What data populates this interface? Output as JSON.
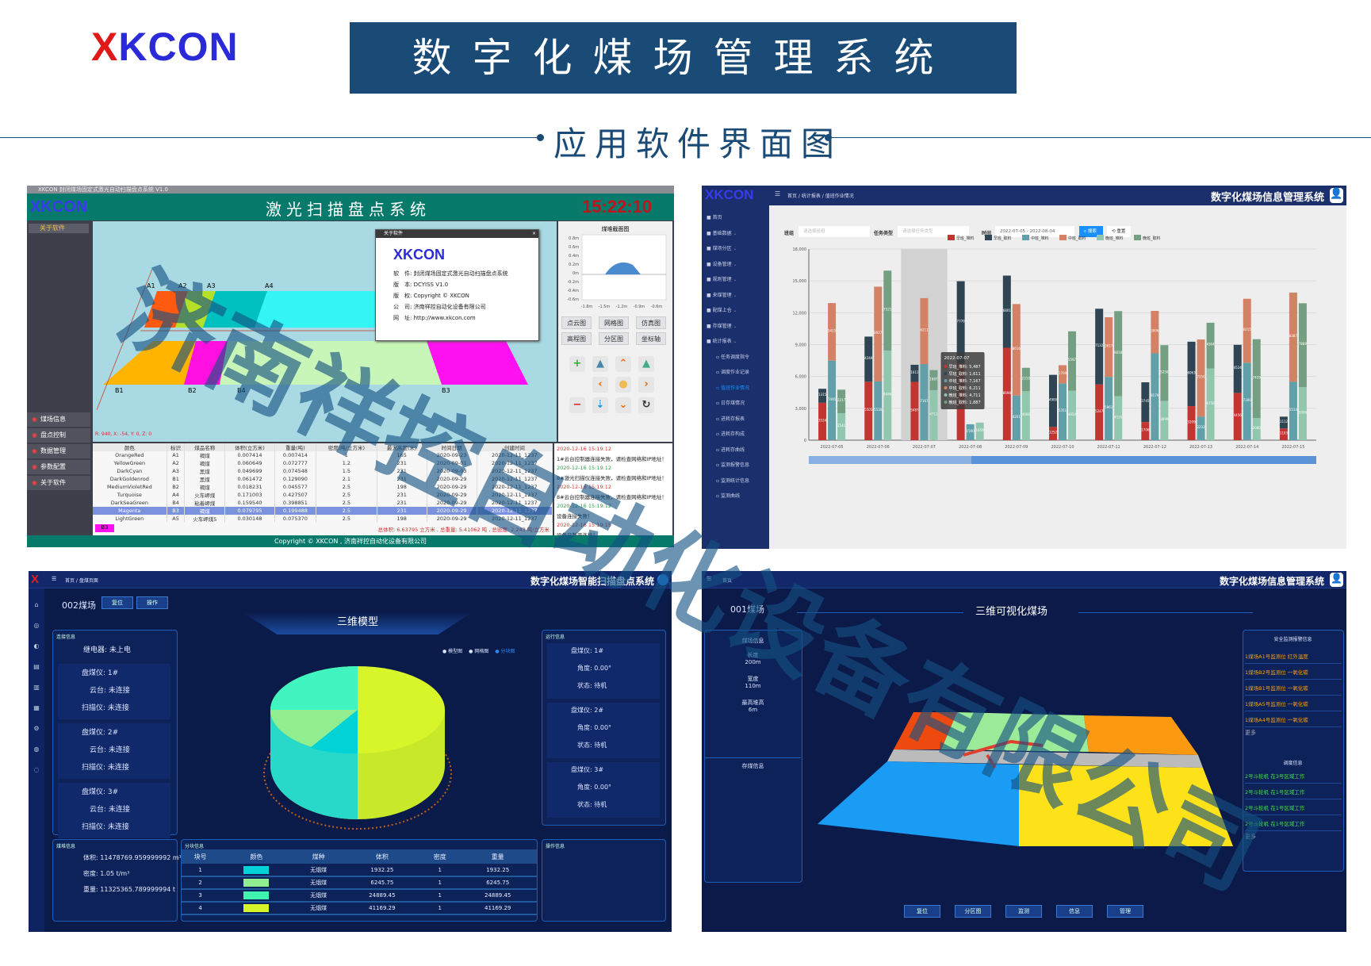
{
  "brand": {
    "logo_x": "X",
    "logo_rest": "KCON",
    "title": "数字化煤场管理系统",
    "subtitle": "应用软件界面图"
  },
  "watermark": "济南祥控自动化设备有限公司",
  "laser": {
    "window_title": "XKCON 封闭煤场固定式激光自动扫描盘点系统 V1.0",
    "logo": "XKCON",
    "title": "激光扫描盘点系统",
    "clock": "15:22:10",
    "clock_color": "#c0141c",
    "side_top": "关于软件",
    "nav": [
      "煤场信息",
      "盘点控制",
      "数据管理",
      "参数配置",
      "关于软件"
    ],
    "zones": {
      "A1": "A1",
      "A2": "A2",
      "A3": "A3",
      "A4": "A4",
      "B1": "B1",
      "B2": "B2",
      "B4": "B4",
      "B3": "B3"
    },
    "coord": "R: 940, X: -54, Y: 0, Z: 0",
    "about": {
      "title": "关于软件",
      "logo": "XKCON",
      "rows": [
        {
          "k": "软　件:",
          "v": "封闭煤场固定式激光自动扫描盘点系统"
        },
        {
          "k": "版　本:",
          "v": "DCYISS V1.0"
        },
        {
          "k": "版　权:",
          "v": "Copyright © XKCON"
        },
        {
          "k": "公　司:",
          "v": "济南祥控自动化设备有限公司"
        },
        {
          "k": "网　址:",
          "v": "http://www.xkcon.com"
        }
      ]
    },
    "section": {
      "title": "煤堆截面图",
      "y_ticks": [
        "0.8m",
        "0.6m",
        "0.4m",
        "0.2m",
        "0m",
        "-0.2m",
        "-0.4m",
        "-0.6m"
      ],
      "x_ticks": [
        "-1.8m",
        "-1.5m",
        "-1.2m",
        "-0.9m",
        "-0.6m"
      ]
    },
    "view_buttons": [
      "点云图",
      "网格图",
      "仿真图",
      "高程图",
      "分区图",
      "坐标轴"
    ],
    "table": {
      "headers": [
        "颜色",
        "标识",
        "煤品名称",
        "体积(立方米)",
        "重量(吨)",
        "密度(吨/立方米)",
        "最大高度(米)",
        "时间日期",
        "创建时间"
      ],
      "rows": [
        [
          "OrangeRed",
          "A1",
          "褐煤",
          "0.007414",
          "0.007414",
          "1",
          "165",
          "2020-09-23",
          "2020-12-11_1237"
        ],
        [
          "YellowGreen",
          "A2",
          "褐煤",
          "0.060649",
          "0.072777",
          "1.2",
          "231",
          "2020-09-01",
          "2020-12-11_1237"
        ],
        [
          "DarkCyan",
          "A3",
          "黑煤",
          "0.049699",
          "0.074548",
          "1.5",
          "231",
          "2020-09-03",
          "2020-12-11_1237"
        ],
        [
          "DarkGoldenrod",
          "B1",
          "黑煤",
          "0.061472",
          "0.129090",
          "2.1",
          "231",
          "2020-09-29",
          "2020-12-11_1237"
        ],
        [
          "MediumVioletRed",
          "B2",
          "褐煤",
          "0.018231",
          "0.045577",
          "2.5",
          "198",
          "2020-09-29",
          "2020-12-11_1237"
        ],
        [
          "Turquoise",
          "A4",
          "火车岬煤",
          "0.171003",
          "0.427507",
          "2.5",
          "231",
          "2020-09-29",
          "2020-12-11_1237"
        ],
        [
          "DarkSeaGreen",
          "B4",
          "粘着岬煤",
          "0.159540",
          "0.398851",
          "2.5",
          "231",
          "2020-09-29",
          "2020-12-11_1237"
        ],
        [
          "Magenta",
          "B3",
          "褐煤",
          "0.079795",
          "0.199488",
          "2.5",
          "231",
          "2020-09-29",
          "2020-12-11_1237"
        ],
        [
          "LightGreen",
          "A5",
          "火车岬煤5",
          "0.030148",
          "0.075370",
          "2.5",
          "198",
          "2020-09-29",
          "2020-12-11_1237"
        ]
      ],
      "selected_index": 7,
      "selected_tag": "B3",
      "summary": "总体积: 6.63795 立方米 ,  总重量: 5.41062 吨 ,  总密度: 2.243 吨/立方米"
    },
    "log": [
      {
        "t": "2020-12-16 15:19:12",
        "c": "#d03030"
      },
      {
        "t": "1#云台控制器连接失败，请检查网络和IP地址！",
        "c": "#222"
      },
      {
        "t": "2020-12-16 15:19:12",
        "c": "#2a9a4a"
      },
      {
        "t": "8#激光扫描仪连接失败，请检查网络和IP地址！",
        "c": "#222"
      },
      {
        "t": "2020-12-16 15:19:12",
        "c": "#d03030"
      },
      {
        "t": "8#云台控制器连接失败，请检查网络和IP地址！",
        "c": "#222"
      },
      {
        "t": "2020-12-16 15:19:12",
        "c": "#2a9a4a"
      },
      {
        "t": "设备连接失败！",
        "c": "#222"
      },
      {
        "t": "2020-12-16 15:19:15",
        "c": "#d03030"
      },
      {
        "t": "设备已断开连接！",
        "c": "#222"
      }
    ],
    "footer": "Copyright © XKCON , 济南祥控自动化设备有限公司"
  },
  "stats": {
    "logo": "XKCON",
    "title": "数字化煤场信息管理系统",
    "breadcrumb": [
      "首页",
      "统计报表",
      "值班作业情况"
    ],
    "sidebar": [
      "首页",
      "基础数据",
      "煤场分区",
      "设备管理",
      "规则管理",
      "来煤管理",
      "配煤上仓",
      "存煤管理",
      "统计报表",
      "任务调度指令",
      "调度作业记录",
      "值班作业情况",
      "日存煤情况",
      "进耗存报表",
      "进耗存构成",
      "进耗存曲线",
      "监测报警信息",
      "监测统计信息",
      "监测曲线"
    ],
    "active_item": "值班作业情况",
    "filters": {
      "group_label": "班组",
      "group_placeholder": "请选择班组",
      "type_label": "任务类型",
      "type_placeholder": "请选择任务类型",
      "time_label": "时间",
      "date_from": "2022-07-05",
      "date_to": "2022-08-04",
      "search": "搜索",
      "reset": "重置"
    },
    "accent": "#1890ff"
  },
  "chart_data": {
    "type": "bar",
    "stacked": true,
    "categories": [
      "2022-07-05",
      "2022-07-06",
      "2022-07-07",
      "2022-07-08",
      "2022-07-09",
      "2022-07-10",
      "2022-07-11",
      "2022-07-12",
      "2022-07-13",
      "2022-07-14",
      "2022-07-15"
    ],
    "ylim": [
      0,
      18000
    ],
    "y_ticks": [
      "0",
      "3,000",
      "6,000",
      "9,000",
      "12,000",
      "15,000",
      "18,000"
    ],
    "grid": true,
    "legend": "top",
    "series": [
      {
        "name": "早班_堆料",
        "stack": "早班",
        "color": "#c23531",
        "values": [
          3524,
          5505,
          5487,
          7200,
          8698,
          1252,
          5247,
          1706,
          3209,
          4456,
          1103
        ]
      },
      {
        "name": "早班_取料",
        "stack": "早班",
        "color": "#2f4554",
        "values": [
          1315,
          4249,
          1611,
          7770,
          6801,
          4900,
          7132,
          3745,
          6063,
          4524,
          1112
        ]
      },
      {
        "name": "中班_堆料",
        "stack": "中班",
        "color": "#61a0a8",
        "values": [
          7495,
          5530,
          7167,
          1500,
          4201,
          5351,
          5961,
          8179,
          2232,
          7300,
          5514
        ]
      },
      {
        "name": "中班_取料",
        "stack": "中班",
        "color": "#d48265",
        "values": [
          5415,
          8927,
          6211,
          0,
          8616,
          1709,
          5617,
          3996,
          7250,
          6015,
          8387
        ]
      },
      {
        "name": "晚班_堆料",
        "stack": "晚班",
        "color": "#91c7ae",
        "values": [
          2541,
          8446,
          4711,
          1659,
          4606,
          4654,
          4135,
          3699,
          6756,
          2080,
          5006
        ]
      },
      {
        "name": "晚班_取料",
        "stack": "晚班",
        "color": "#749f83",
        "values": [
          2217,
          7521,
          1887,
          0,
          2210,
          5597,
          8018,
          5250,
          4304,
          7429,
          7889
        ]
      }
    ],
    "tooltip": {
      "title": "2022-07-07",
      "rows": [
        "早班_堆料: 5,487",
        "早班_取料: 1,611",
        "中班_堆料: 7,167",
        "中班_取料: 6,211",
        "晚班_堆料: 4,711",
        "晚班_取料: 1,887"
      ]
    }
  },
  "scan": {
    "title": "数字化煤场智能扫描盘点系统",
    "breadcrumb": [
      "首页",
      "盘煤页面"
    ],
    "yard": "002煤场",
    "buttons": [
      "复位",
      "操作"
    ],
    "tab": "三维模型",
    "radios": [
      "模型图",
      "网格图",
      "分块图"
    ],
    "radio_selected": 2,
    "conn": {
      "title": "连接信息",
      "relay": "继电器: 未上电",
      "devices": [
        {
          "name": "盘煤仪: 1#",
          "ptz": "云台: 未连接",
          "scanner": "扫描仪: 未连接"
        },
        {
          "name": "盘煤仪: 2#",
          "ptz": "云台: 未连接",
          "scanner": "扫描仪: 未连接"
        },
        {
          "name": "盘煤仪: 3#",
          "ptz": "云台: 未连接",
          "scanner": "扫描仪: 未连接"
        }
      ]
    },
    "run": {
      "title": "运行信息",
      "devices": [
        {
          "name": "盘煤仪: 1#",
          "angle": "角度: 0.00°",
          "state": "状态: 待机"
        },
        {
          "name": "盘煤仪: 2#",
          "angle": "角度: 0.00°",
          "state": "状态: 待机"
        },
        {
          "name": "盘煤仪: 3#",
          "angle": "角度: 0.00°",
          "state": "状态: 待机"
        }
      ]
    },
    "pile": {
      "title": "煤堆信息",
      "volume": "体积: 11478769.959999992 m³",
      "density": "密度: 1.05 t/m³",
      "weight": "重量: 11325365.789999994 t"
    },
    "blocks": {
      "title": "分块信息",
      "headers": [
        "块号",
        "颜色",
        "煤种",
        "体积",
        "密度",
        "重量"
      ],
      "rows": [
        {
          "id": "1",
          "color": "#00d2d6",
          "type": "无烟煤",
          "volume": "1932.25",
          "density": "1",
          "weight": "1932.25"
        },
        {
          "id": "2",
          "color": "#90ee90",
          "type": "无烟煤",
          "volume": "6245.75",
          "density": "1",
          "weight": "6245.75"
        },
        {
          "id": "3",
          "color": "#40f5b0",
          "type": "无烟煤",
          "volume": "24889.45",
          "density": "1",
          "weight": "24889.45"
        },
        {
          "id": "4",
          "color": "#d8f52a",
          "type": "无烟煤",
          "volume": "41169.29",
          "density": "1",
          "weight": "41169.29"
        }
      ]
    },
    "ops": {
      "title": "操作信息"
    }
  },
  "visual": {
    "title": "数字化煤场信息管理系统",
    "breadcrumb": "首页",
    "yard": "001煤场",
    "scene_title": "三维可视化煤场",
    "yard_info": {
      "title": "煤场信息",
      "items": [
        {
          "k": "长度",
          "v": "200m"
        },
        {
          "k": "宽度",
          "v": "110m"
        },
        {
          "k": "最高堆高",
          "v": "6m"
        }
      ]
    },
    "storage_title": "存煤信息",
    "alarms": {
      "title": "安全监测报警信息",
      "items": [
        "1煤场A1号监测位 红外温度",
        "1煤场B2号监测位 一氧化碳",
        "1煤场B1号监测位 一氧化碳",
        "1煤场A5号监测位 一氧化碳",
        "1煤场A4号监测位 一氧化碳"
      ],
      "more": "更多",
      "color": "#f0a020"
    },
    "dispatch": {
      "title": "调度信息",
      "items": [
        "2号斗轮机 在3号区域工作",
        "2号斗轮机 在1号区域工作",
        "2号斗轮机 在1号区域工作",
        "2号斗轮机 在1号区域工作"
      ],
      "more": "更多",
      "color": "#3ee04a"
    },
    "buttons": [
      "复位",
      "分区图",
      "监测",
      "信息",
      "管理"
    ]
  }
}
